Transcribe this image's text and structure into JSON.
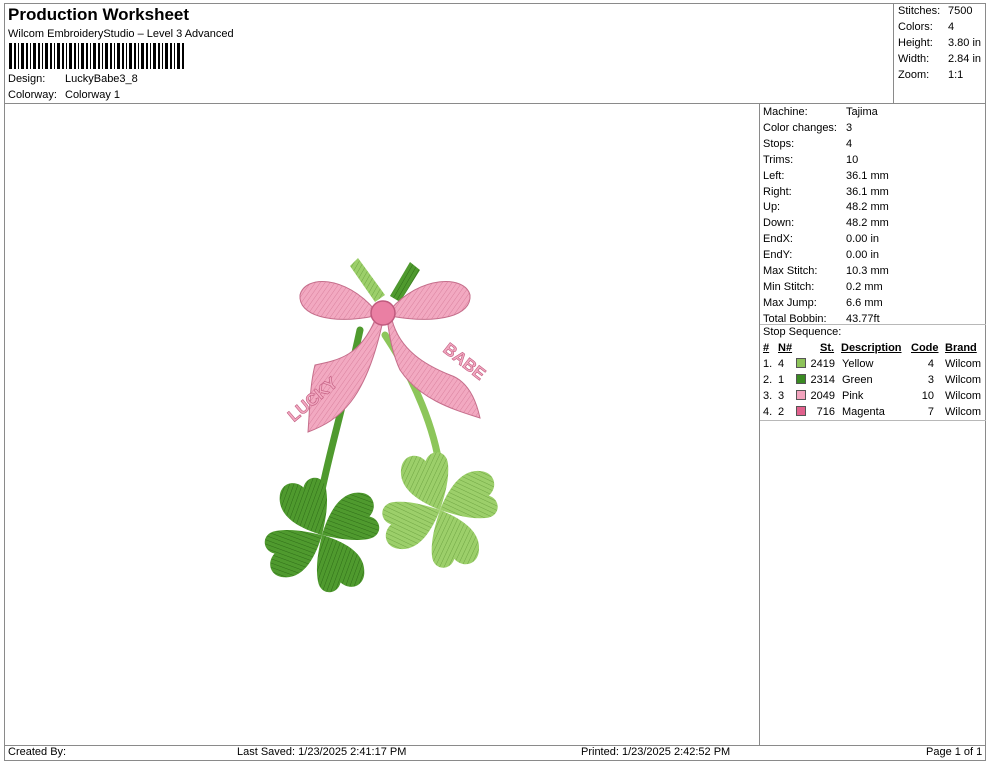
{
  "header": {
    "title": "Production Worksheet",
    "subtitle": "Wilcom EmbroideryStudio – Level 3 Advanced",
    "design_label": "Design:",
    "design_value": "LuckyBabe3_8",
    "colorway_label": "Colorway:",
    "colorway_value": "Colorway 1"
  },
  "stats": [
    {
      "label": "Stitches:",
      "value": "7500"
    },
    {
      "label": "Colors:",
      "value": "4"
    },
    {
      "label": "Height:",
      "value": "3.80 in"
    },
    {
      "label": "Width:",
      "value": "2.84 in"
    },
    {
      "label": "Zoom:",
      "value": "1:1"
    }
  ],
  "machine_info": [
    {
      "label": "Machine:",
      "value": "Tajima"
    },
    {
      "label": "Color changes:",
      "value": "3"
    },
    {
      "label": "Stops:",
      "value": "4"
    },
    {
      "label": "Trims:",
      "value": "10"
    },
    {
      "label": "Left:",
      "value": "36.1 mm"
    },
    {
      "label": "Right:",
      "value": "36.1 mm"
    },
    {
      "label": "Up:",
      "value": "48.2 mm"
    },
    {
      "label": "Down:",
      "value": "48.2 mm"
    },
    {
      "label": "EndX:",
      "value": "0.00 in"
    },
    {
      "label": "EndY:",
      "value": "0.00 in"
    },
    {
      "label": "Max Stitch:",
      "value": "10.3 mm"
    },
    {
      "label": "Min Stitch:",
      "value": "0.2 mm"
    },
    {
      "label": "Max Jump:",
      "value": "6.6 mm"
    },
    {
      "label": "Total Bobbin:",
      "value": "43.77ft"
    }
  ],
  "stop_sequence": {
    "title": "Stop Sequence:",
    "headers": {
      "num": "#",
      "n": "N#",
      "st": "St.",
      "description": "Description",
      "code": "Code",
      "brand": "Brand"
    },
    "rows": [
      {
        "num": "1.",
        "n": "4",
        "color": "#8dc35a",
        "st": "2419",
        "description": "Yellow",
        "code": "4",
        "brand": "Wilcom"
      },
      {
        "num": "2.",
        "n": "1",
        "color": "#3a8a22",
        "st": "2314",
        "description": "Green",
        "code": "3",
        "brand": "Wilcom"
      },
      {
        "num": "3.",
        "n": "3",
        "color": "#f2a3bd",
        "st": "2049",
        "description": "Pink",
        "code": "10",
        "brand": "Wilcom"
      },
      {
        "num": "4.",
        "n": "2",
        "color": "#e0608c",
        "st": "716",
        "description": "Magenta",
        "code": "7",
        "brand": "Wilcom"
      }
    ]
  },
  "design_text": {
    "left_word": "LUCKY",
    "right_word": "BABE"
  },
  "footer": {
    "created_by": "Created By:",
    "last_saved": "Last Saved: 1/23/2025 2:41:17 PM",
    "printed": "Printed: 1/23/2025 2:42:52 PM",
    "page": "Page 1 of 1"
  }
}
